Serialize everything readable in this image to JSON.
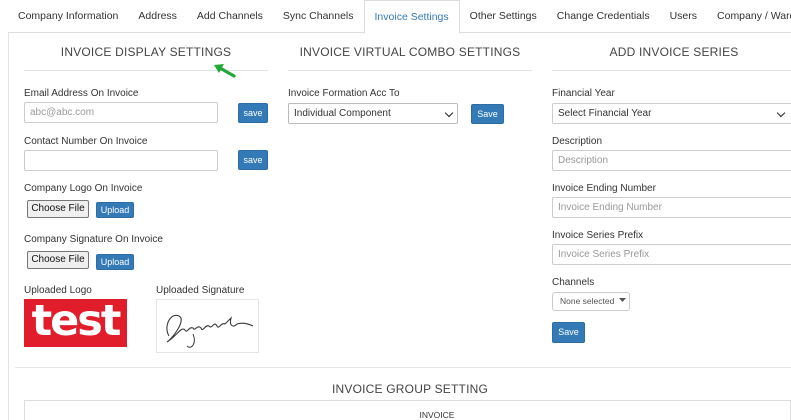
{
  "tabs": [
    {
      "label": "Company Information",
      "active": false
    },
    {
      "label": "Address",
      "active": false
    },
    {
      "label": "Add Channels",
      "active": false
    },
    {
      "label": "Sync Channels",
      "active": false
    },
    {
      "label": "Invoice Settings",
      "active": true
    },
    {
      "label": "Other Settings",
      "active": false
    },
    {
      "label": "Change Credentials",
      "active": false
    },
    {
      "label": "Users",
      "active": false
    },
    {
      "label": "Company / Warehouse",
      "active": false
    }
  ],
  "display": {
    "title": "INVOICE DISPLAY SETTINGS",
    "email_label": "Email Address On Invoice",
    "email_placeholder": "abc@abc.com",
    "email_save": "save",
    "contact_label": "Contact Number On Invoice",
    "contact_value": "",
    "contact_save": "save",
    "logo_label": "Company Logo On Invoice",
    "logo_choose": "Choose File",
    "logo_upload": "Upload",
    "signature_label": "Company Signature On Invoice",
    "signature_choose": "Choose File",
    "signature_upload": "Upload",
    "uploaded_logo_label": "Uploaded Logo",
    "uploaded_logo_text": "test",
    "uploaded_signature_label": "Uploaded Signature",
    "uploaded_signature_text": "Signature"
  },
  "combo": {
    "title": "INVOICE VIRTUAL COMBO SETTINGS",
    "formation_label": "Invoice Formation Acc To",
    "formation_value": "Individual Component",
    "save": "Save"
  },
  "series": {
    "title": "ADD INVOICE SERIES",
    "fy_label": "Financial Year",
    "fy_value": "Select Financial Year",
    "desc_label": "Description",
    "desc_placeholder": "Description",
    "end_label": "Invoice Ending Number",
    "end_placeholder": "Invoice Ending Number",
    "prefix_label": "Invoice Series Prefix",
    "prefix_placeholder": "Invoice Series Prefix",
    "channels_label": "Channels",
    "channels_value": "None selected",
    "save": "Save"
  },
  "group": {
    "title": "INVOICE GROUP SETTING",
    "subtitle": "INVOICE"
  },
  "colors": {
    "primary": "#337ab7",
    "active_tab_text": "#337ab7",
    "logo_red": "#e11d2b",
    "pointer_green": "#22a93a"
  },
  "icons": [
    "chevron-down-icon",
    "caret-down-icon",
    "green-arrow-icon"
  ]
}
